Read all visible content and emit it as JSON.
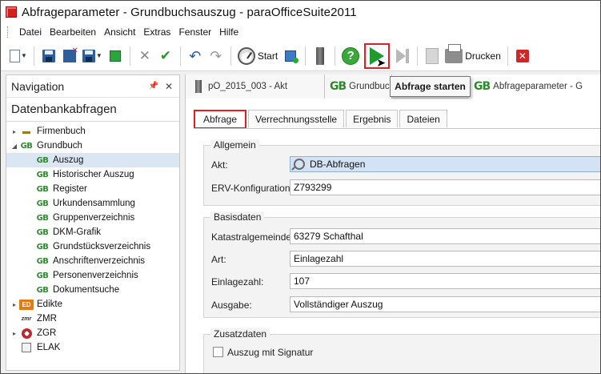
{
  "window": {
    "title": "Abfrageparameter - Grundbuchsauszug - paraOfficeSuite2011"
  },
  "menu": {
    "items": [
      "Datei",
      "Bearbeiten",
      "Ansicht",
      "Extras",
      "Fenster",
      "Hilfe"
    ]
  },
  "toolbar": {
    "start_label": "Start",
    "print_label": "Drucken",
    "tooltip": "Abfrage starten"
  },
  "navigation": {
    "header": "Navigation",
    "section_title": "Datenbankabfragen",
    "tree": [
      {
        "label": "Firmenbuch",
        "icon": "firmenbuch-icon",
        "toggle": "▸",
        "level": 0
      },
      {
        "label": "Grundbuch",
        "icon": "gb-icon",
        "toggle": "◢",
        "level": 0
      },
      {
        "label": "Auszug",
        "icon": "gb-icon",
        "level": 1,
        "selected": true
      },
      {
        "label": "Historischer Auszug",
        "icon": "gb-icon",
        "level": 1
      },
      {
        "label": "Register",
        "icon": "gb-icon",
        "level": 1
      },
      {
        "label": "Urkundensammlung",
        "icon": "gb-icon",
        "level": 1
      },
      {
        "label": "Gruppenverzeichnis",
        "icon": "gb-icon",
        "level": 1
      },
      {
        "label": "DKM-Grafik",
        "icon": "gb-icon",
        "level": 1
      },
      {
        "label": "Grundstücksverzeichnis",
        "icon": "gb-icon",
        "level": 1
      },
      {
        "label": "Anschriftenverzeichnis",
        "icon": "gb-icon",
        "level": 1
      },
      {
        "label": "Personenverzeichnis",
        "icon": "gb-icon",
        "level": 1
      },
      {
        "label": "Dokumentsuche",
        "icon": "gb-icon",
        "level": 1
      },
      {
        "label": "Edikte",
        "icon": "edikte-icon",
        "toggle": "▸",
        "level": 0
      },
      {
        "label": "ZMR",
        "icon": "zmr-icon",
        "level": 0
      },
      {
        "label": "ZGR",
        "icon": "zgr-icon",
        "toggle": "▸",
        "level": 0
      },
      {
        "label": "ELAK",
        "icon": "elak-icon",
        "level": 0
      }
    ]
  },
  "doc_tabs": [
    {
      "label": "pO_2015_003 - Akt"
    },
    {
      "label": "Grundbuch"
    },
    {
      "label": "Abfrageparameter - G"
    }
  ],
  "sub_tabs": [
    "Abfrage",
    "Verrechnungsstelle",
    "Ergebnis",
    "Dateien"
  ],
  "form": {
    "allgemein": {
      "title": "Allgemein",
      "akt_label": "Akt:",
      "akt_value": "DB-Abfragen",
      "erv_label": "ERV-Konfiguration:",
      "erv_value": "Z793299"
    },
    "basisdaten": {
      "title": "Basisdaten",
      "kg_label": "Katastralgemeinde:",
      "kg_value": "63279 Schafthal",
      "art_label": "Art:",
      "art_value": "Einlagezahl",
      "ez_label": "Einlagezahl:",
      "ez_value": "107",
      "ausgabe_label": "Ausgabe:",
      "ausgabe_value": "Vollständiger Auszug"
    },
    "zusatzdaten": {
      "title": "Zusatzdaten",
      "signatur_label": "Auszug mit Signatur"
    }
  }
}
